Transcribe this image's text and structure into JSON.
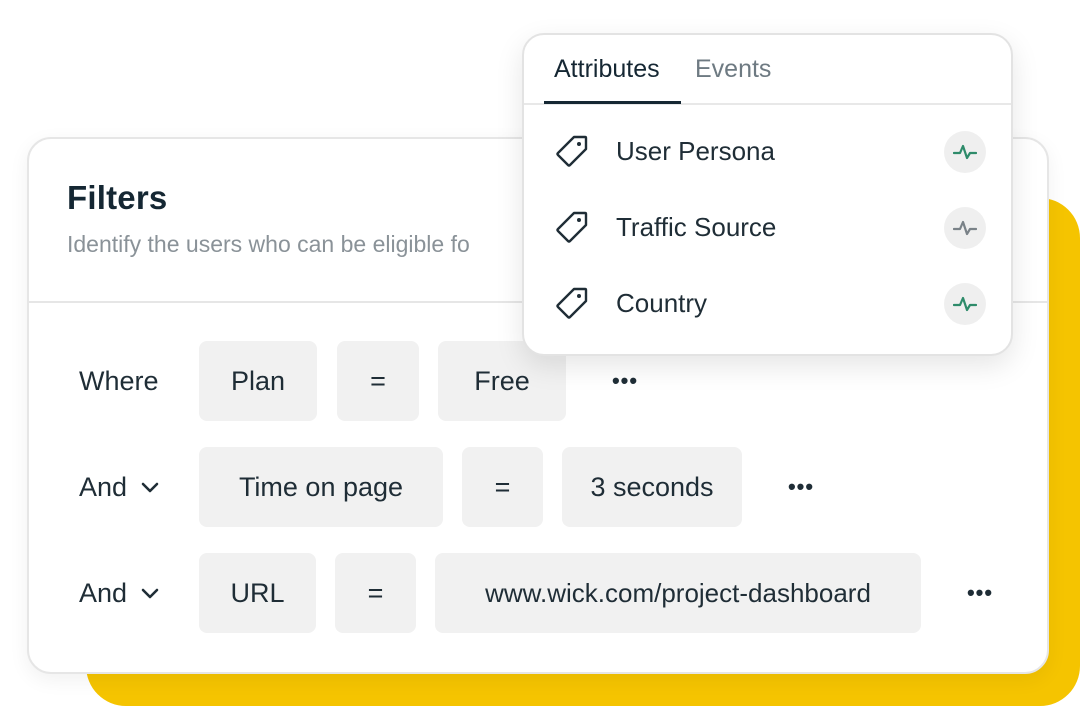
{
  "filters": {
    "title": "Filters",
    "subtitle": "Identify the users who can be eligible fo",
    "rows": [
      {
        "label": "Where",
        "field": "Plan",
        "operator": "=",
        "value": "Free",
        "more": "•••"
      },
      {
        "label": "And",
        "field": "Time on page",
        "operator": "=",
        "value": "3 seconds",
        "more": "•••"
      },
      {
        "label": "And",
        "field": "URL",
        "operator": "=",
        "value": "www.wick.com/project-dashboard",
        "more": "•••"
      }
    ]
  },
  "popover": {
    "tabs": [
      {
        "label": "Attributes",
        "active": true
      },
      {
        "label": "Events",
        "active": false
      }
    ],
    "items": [
      {
        "label": "User Persona",
        "icon": "tag-icon",
        "status_icon": "activity-icon",
        "status_color": "#2e8b6a"
      },
      {
        "label": "Traffic Source",
        "icon": "tag-icon",
        "status_icon": "activity-icon",
        "status_color": "#7a8288"
      },
      {
        "label": "Country",
        "icon": "tag-icon",
        "status_icon": "activity-icon",
        "status_color": "#2e8b6a"
      }
    ]
  },
  "colors": {
    "accent_yellow": "#f5c400",
    "text_dark": "#152733",
    "muted": "#8a9298",
    "pill_bg": "#f1f1f1"
  }
}
